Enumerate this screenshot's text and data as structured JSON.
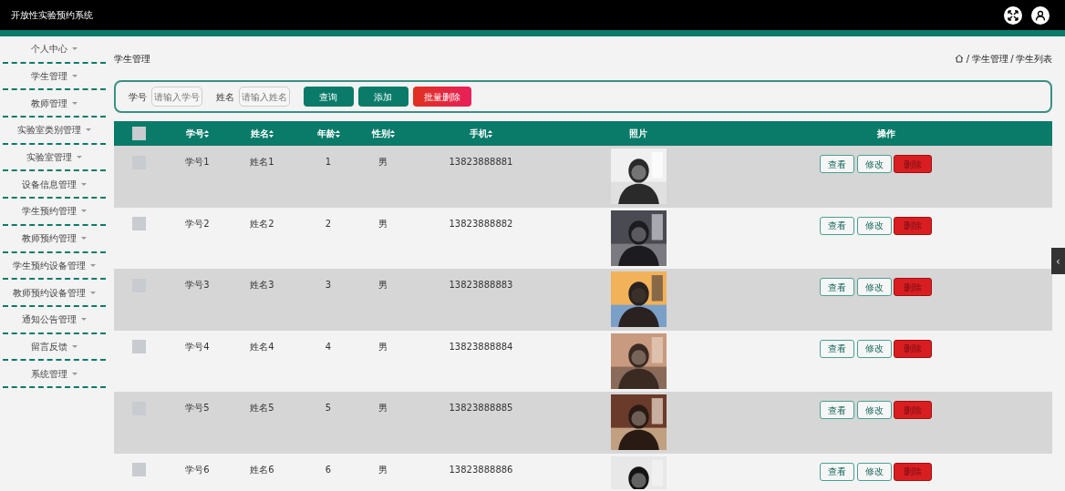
{
  "app_title": "开放性实验预约系统",
  "sidebar": {
    "items": [
      {
        "label": "个人中心"
      },
      {
        "label": "学生管理"
      },
      {
        "label": "教师管理"
      },
      {
        "label": "实验室类别管理"
      },
      {
        "label": "实验室管理"
      },
      {
        "label": "设备信息管理"
      },
      {
        "label": "学生预约管理"
      },
      {
        "label": "教师预约管理"
      },
      {
        "label": "学生预约设备管理"
      },
      {
        "label": "教师预约设备管理"
      },
      {
        "label": "通知公告管理"
      },
      {
        "label": "留言反馈"
      },
      {
        "label": "系统管理"
      }
    ]
  },
  "page_title": "学生管理",
  "breadcrumb": {
    "separator": "/",
    "items": [
      "学生管理",
      "学生列表"
    ]
  },
  "search": {
    "fields": [
      {
        "label": "学号",
        "placeholder": "请输入学号"
      },
      {
        "label": "姓名",
        "placeholder": "请输入姓名"
      }
    ],
    "buttons": [
      {
        "label": "查询",
        "kind": "primary"
      },
      {
        "label": "添加",
        "kind": "primary"
      },
      {
        "label": "批量删除",
        "kind": "danger"
      }
    ]
  },
  "table": {
    "select_all": {
      "checked": false
    },
    "columns": [
      {
        "label": "学号",
        "sortable": true
      },
      {
        "label": "姓名",
        "sortable": true
      },
      {
        "label": "年龄",
        "sortable": true
      },
      {
        "label": "性别",
        "sortable": true
      },
      {
        "label": "手机",
        "sortable": true
      },
      {
        "label": "照片",
        "sortable": false
      },
      {
        "label": "操作",
        "sortable": false
      }
    ],
    "rows": [
      {
        "checked": false,
        "cells": [
          "学号1",
          "姓名1",
          "1",
          "男",
          "13823888881"
        ],
        "photo": {
          "kind": "picture"
        },
        "actions": [
          "查看",
          "修改",
          "删除"
        ]
      },
      {
        "checked": false,
        "cells": [
          "学号2",
          "姓名2",
          "2",
          "男",
          "13823888882"
        ],
        "photo": {
          "kind": "picture"
        },
        "actions": [
          "查看",
          "修改",
          "删除"
        ]
      },
      {
        "checked": false,
        "cells": [
          "学号3",
          "姓名3",
          "3",
          "男",
          "13823888883"
        ],
        "photo": {
          "kind": "picture"
        },
        "actions": [
          "查看",
          "修改",
          "删除"
        ]
      },
      {
        "checked": false,
        "cells": [
          "学号4",
          "姓名4",
          "4",
          "男",
          "13823888884"
        ],
        "photo": {
          "kind": "picture"
        },
        "actions": [
          "查看",
          "修改",
          "删除"
        ]
      },
      {
        "checked": false,
        "cells": [
          "学号5",
          "姓名5",
          "5",
          "男",
          "13823888885"
        ],
        "photo": {
          "kind": "picture"
        },
        "actions": [
          "查看",
          "修改",
          "删除"
        ]
      },
      {
        "checked": false,
        "cells": [
          "学号6",
          "姓名6",
          "6",
          "男",
          "13823888886"
        ],
        "photo": {
          "kind": "picture"
        },
        "actions": [
          "查看",
          "修改",
          "删除"
        ]
      }
    ]
  },
  "side_toggle": "‹"
}
